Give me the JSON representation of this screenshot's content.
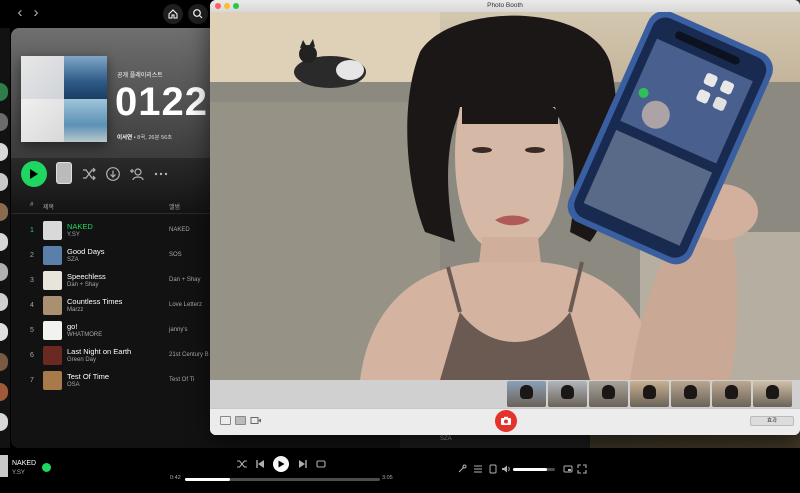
{
  "spotify": {
    "playlist": {
      "type_label": "공개 플레이리스트",
      "title": "0122",
      "owner": "이서연",
      "meta": " • 8곡, 26분 56초"
    },
    "columns": {
      "num": "#",
      "title": "제목",
      "album": "앨범"
    },
    "tracks": [
      {
        "num": "1",
        "title": "NAKED",
        "artist": "Y.SY",
        "album": "NAKED",
        "color": "#d9d9d9"
      },
      {
        "num": "2",
        "title": "Good Days",
        "artist": "SZA",
        "album": "SOS",
        "color": "#5a7fa8"
      },
      {
        "num": "3",
        "title": "Speechless",
        "artist": "Dan + Shay",
        "album": "Dan + Shay",
        "color": "#e8e4dc"
      },
      {
        "num": "4",
        "title": "Countless Times",
        "artist": "Marzz",
        "album": "Love Letterz",
        "color": "#a89070"
      },
      {
        "num": "5",
        "title": "go!",
        "artist": "WHATMORE",
        "album": "janny's",
        "color": "#f2f2ee"
      },
      {
        "num": "6",
        "title": "Last Night on Earth",
        "artist": "Green Day",
        "album": "21st Century B",
        "color": "#6a2a22"
      },
      {
        "num": "7",
        "title": "Test Of Time",
        "artist": "OSA",
        "album": "Test Of Ti",
        "color": "#a87a4a"
      }
    ],
    "now_playing": {
      "title": "NAKED",
      "artist": "Y.SY",
      "elapsed": "0:42",
      "duration": "3:05",
      "progress": 0.23,
      "volume": 0.8
    },
    "peek_artist": "SZA"
  },
  "photobooth": {
    "title": "Photo Booth",
    "effects_label": "효과",
    "thumb_colors": [
      "#8aa0b8",
      "#b0b6bc",
      "#a8a49a",
      "#c8b090",
      "#b8a690",
      "#bca890",
      "#d0c0a8"
    ]
  },
  "colors": {
    "spotify_green": "#1ed760",
    "shutter_red": "#e4332c"
  }
}
